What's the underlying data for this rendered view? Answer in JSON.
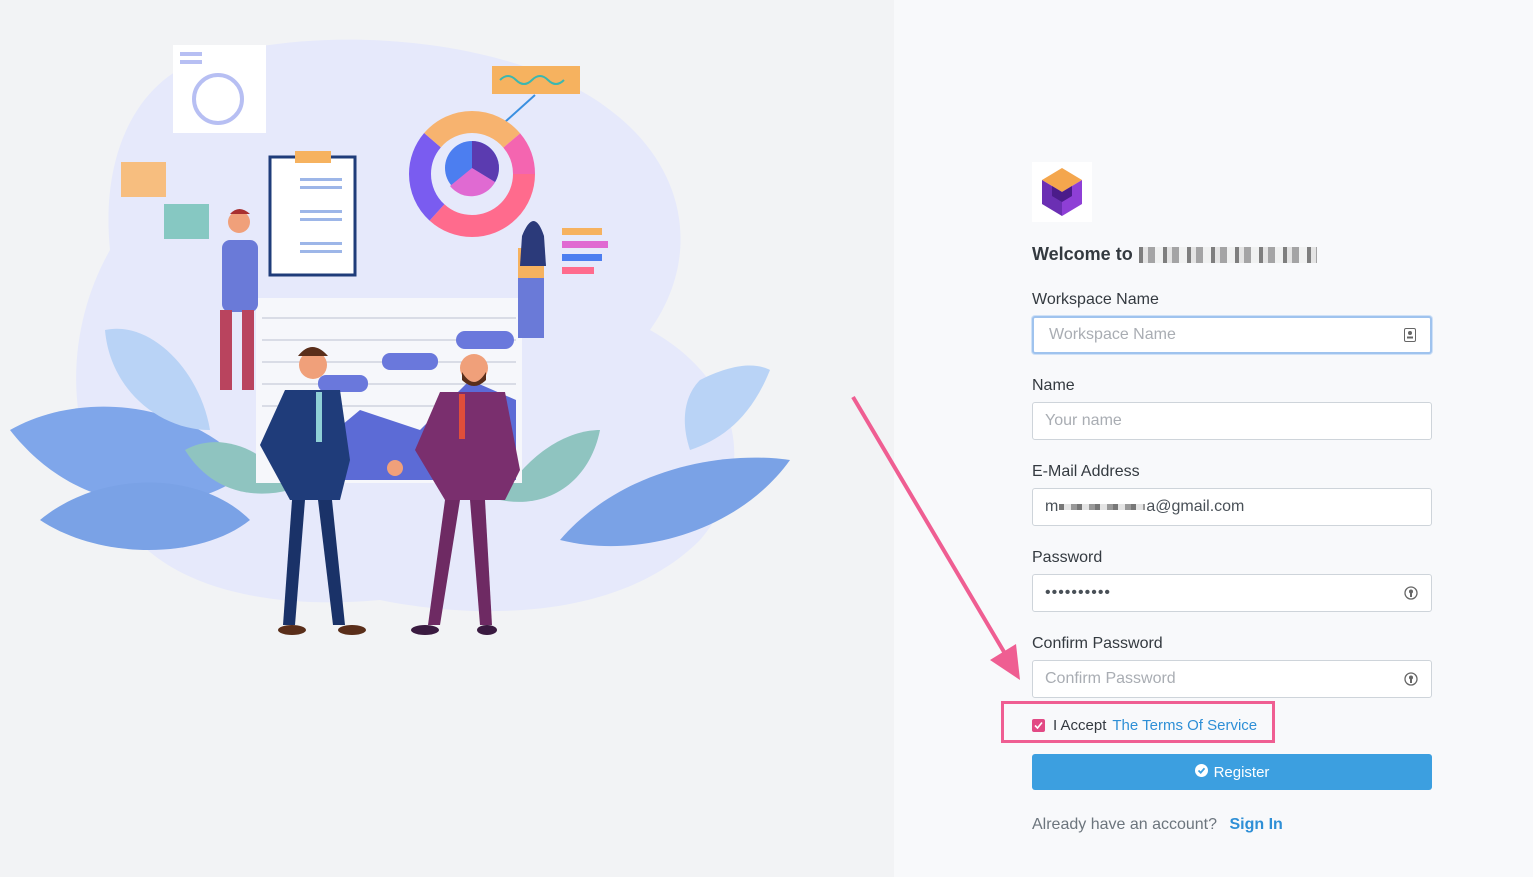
{
  "branding": {
    "welcome_text": "Welcome to"
  },
  "form": {
    "workspace": {
      "label": "Workspace Name",
      "placeholder": "Workspace Name"
    },
    "name": {
      "label": "Name",
      "placeholder": "Your name"
    },
    "email": {
      "label": "E-Mail Address",
      "value_prefix": "m",
      "value_suffix": "a@gmail.com"
    },
    "password": {
      "label": "Password",
      "value": "••••••••••"
    },
    "confirm_password": {
      "label": "Confirm Password",
      "placeholder": "Confirm Password"
    },
    "terms": {
      "prefix": "I Accept",
      "link": "The Terms Of Service",
      "checked": true
    },
    "register_label": "Register",
    "signin_prompt": "Already have an account?",
    "signin_link": "Sign In"
  },
  "colors": {
    "accent": "#3c9fe0",
    "highlight": "#ef5e92",
    "checkbox": "#e24a85",
    "link": "#2e8fd6"
  }
}
